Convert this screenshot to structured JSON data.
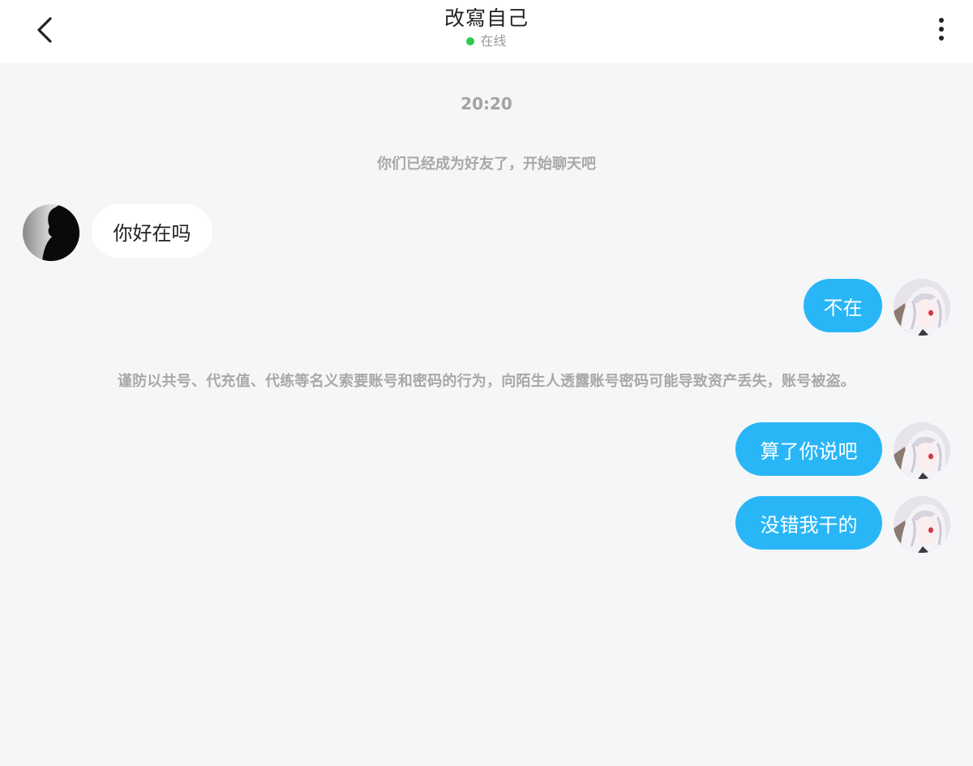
{
  "header": {
    "title": "改寫自己",
    "status": "在线",
    "status_color": "#2dc84d",
    "back_icon": "chevron-left-icon",
    "more_icon": "more-vertical-icon"
  },
  "chat": {
    "timestamp": "20:20",
    "system_notice_friends": "你们已经成为好友了，开始聊天吧",
    "system_notice_warning": "谨防以共号、代充值、代练等名义索要账号和密码的行为，向陌生人透露账号密码可能导致资产丢失，账号被盗。",
    "messages": [
      {
        "side": "incoming",
        "text": "你好在吗"
      },
      {
        "side": "outgoing",
        "text": "不在"
      },
      {
        "side": "outgoing",
        "text": "算了你说吧"
      },
      {
        "side": "outgoing",
        "text": "没错我干的"
      }
    ],
    "outgoing_bubble_color": "#29b6f6",
    "incoming_bubble_color": "#ffffff"
  }
}
